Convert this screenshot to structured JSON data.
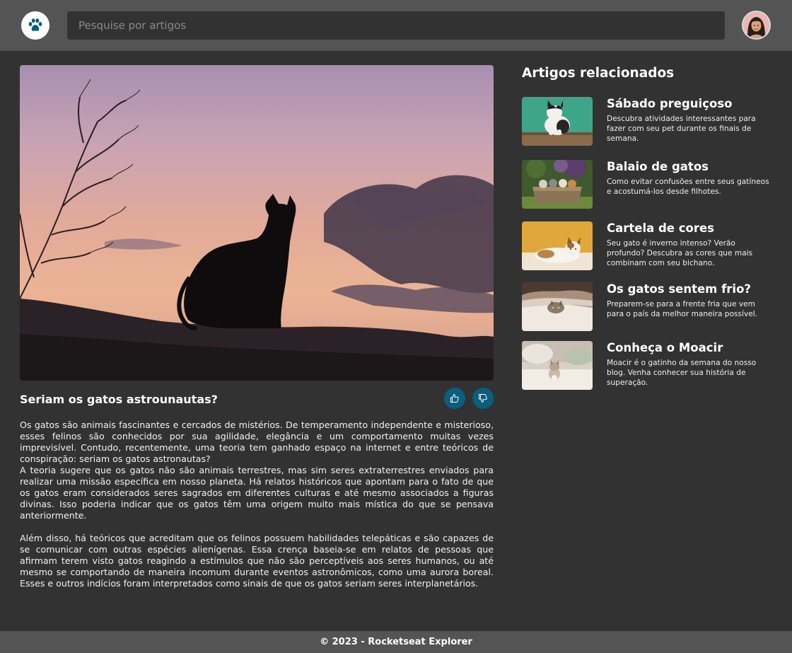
{
  "header": {
    "logo_icon": "paw-icon",
    "search_placeholder": "Pesquise por artigos",
    "avatar_icon": "user-avatar"
  },
  "article": {
    "image_icon": "cat-silhouette-sunset-image",
    "title": "Seriam os gatos astrounautas?",
    "like_icon": "thumbs-up-icon",
    "dislike_icon": "thumbs-down-icon",
    "paragraphs": [
      "Os gatos são animais fascinantes e cercados de mistérios. De temperamento independente e misterioso, esses felinos são conhecidos por sua agilidade, elegância e um comportamento muitas vezes imprevisível. Contudo, recentemente, uma teoria tem ganhado espaço na internet e entre teóricos de conspiração: seriam os gatos astronautas?",
      "A teoria sugere que os gatos não são animais terrestres, mas sim seres extraterrestres enviados para realizar uma missão específica em nosso planeta. Há relatos históricos que apontam para o fato de que os gatos eram considerados seres sagrados em diferentes culturas e até mesmo associados a figuras divinas. Isso poderia indicar que os gatos têm uma origem muito mais mística do que se pensava anteriormente.",
      "Além disso, há teóricos que acreditam que os felinos possuem habilidades telepáticas e são capazes de se comunicar com outras espécies alienígenas. Essa crença baseia-se em relatos de pessoas que afirmam terem visto gatos reagindo a estímulos que não são perceptíveis aos seres humanos, ou até mesmo se comportando de maneira incomum durante eventos astronômicos, como uma aurora boreal. Esses e outros indícios foram interpretados como sinais de que os gatos seriam seres interplanetários."
    ]
  },
  "sidebar": {
    "title": "Artigos relacionados",
    "items": [
      {
        "title": "Sábado preguiçoso",
        "description": "Descubra atividades interessantes para fazer com seu pet durante os finais de semana.",
        "thumb_icon": "cat-on-box-image"
      },
      {
        "title": "Balaio de gatos",
        "description": "Como evitar confusões entre seus gatíneos e acostumá-los desde filhotes.",
        "thumb_icon": "kittens-in-basket-image"
      },
      {
        "title": "Cartela de cores",
        "description": "Seu gato é inverno intenso? Verão profundo? Descubra as cores que mais combinam com seu bichano.",
        "thumb_icon": "cat-on-yellow-image"
      },
      {
        "title": "Os gatos sentem frio?",
        "description": "Preparem-se para a frente fria que vem para o país da melhor maneira possível.",
        "thumb_icon": "cat-under-blanket-image"
      },
      {
        "title": "Conheça o Moacir",
        "description": "Moacir é o gatinho da semana do nosso blog. Venha conhecer sua história de superação.",
        "thumb_icon": "kitten-on-bed-image"
      }
    ]
  },
  "footer": {
    "text": "© 2023 - Rocketseat Explorer"
  }
}
